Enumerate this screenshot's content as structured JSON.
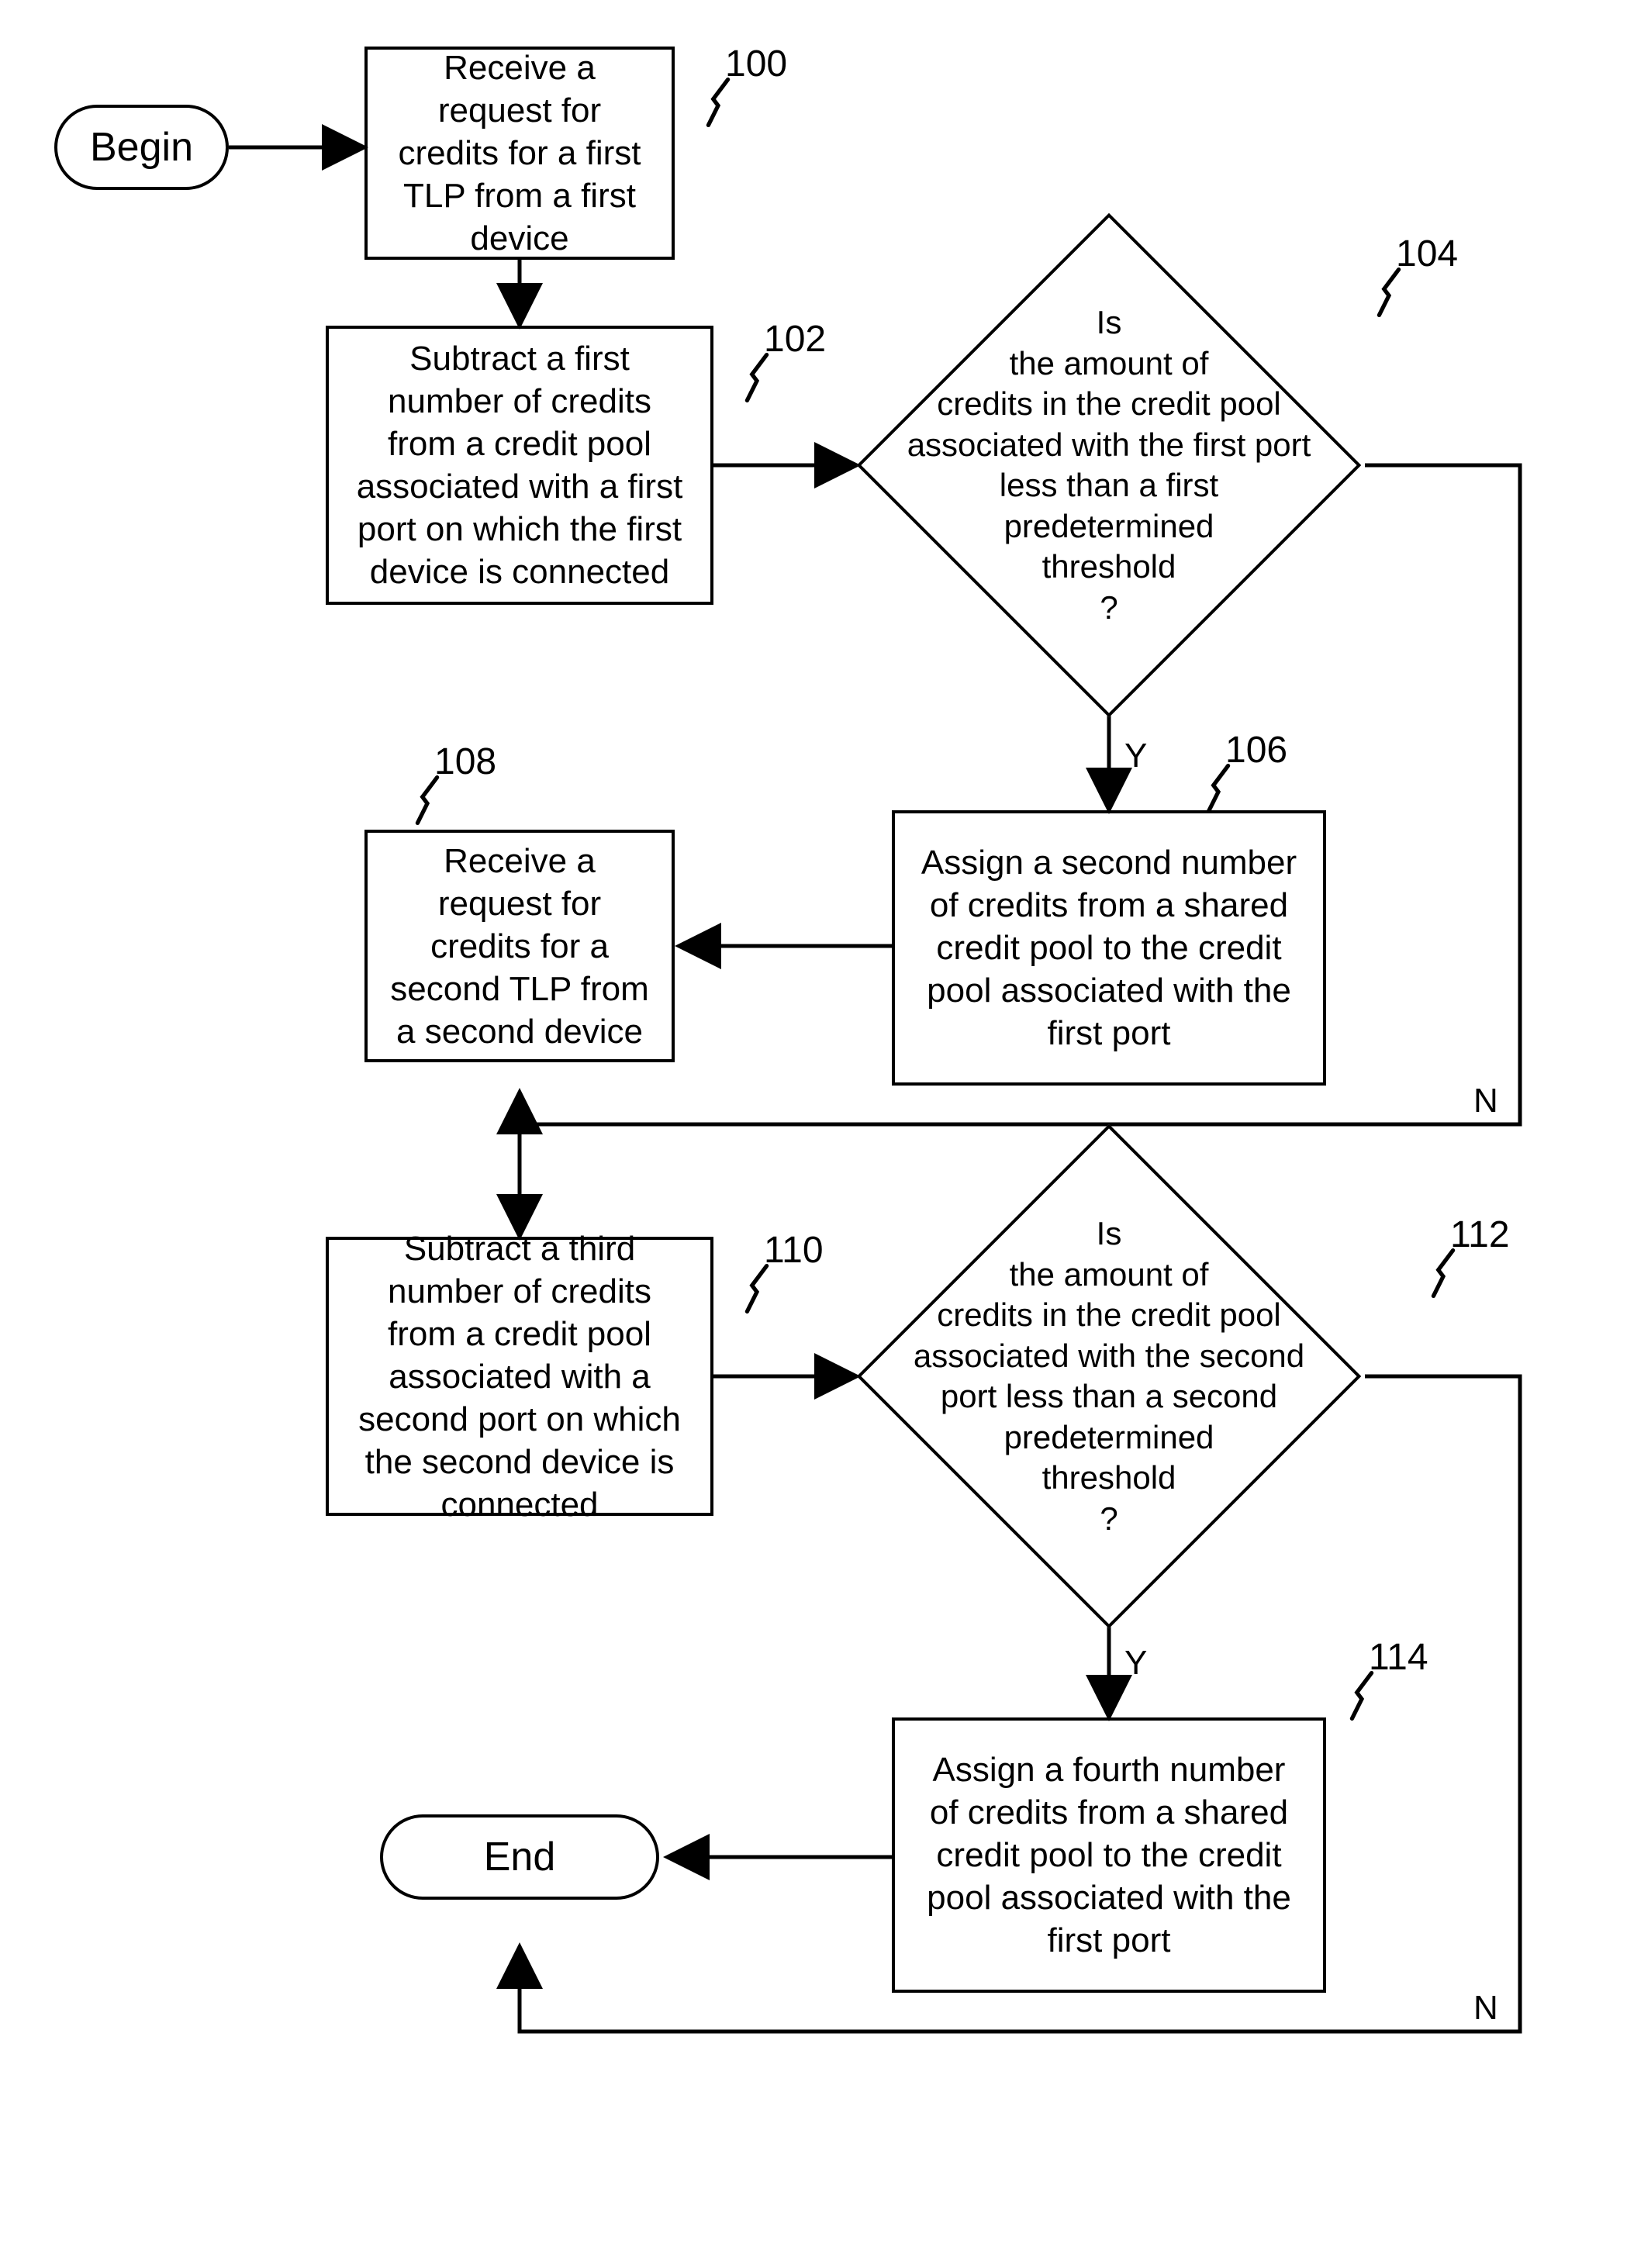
{
  "nodes": {
    "begin": {
      "label": "Begin"
    },
    "end": {
      "label": "End"
    },
    "step100": {
      "ref": "100",
      "text": "Receive a request for credits for a first TLP from a first device"
    },
    "step102": {
      "ref": "102",
      "text": "Subtract a first number of credits from a credit pool associated with a first port on which the first device is connected"
    },
    "dec104": {
      "ref": "104",
      "text": "Is\nthe amount of\ncredits in the credit pool\nassociated with the first port\nless than a first\npredetermined\nthreshold\n?"
    },
    "step106": {
      "ref": "106",
      "text": "Assign a second number of credits from a shared credit pool to the credit pool associated with the first port"
    },
    "step108": {
      "ref": "108",
      "text": "Receive a request for credits for a second TLP from a second device"
    },
    "step110": {
      "ref": "110",
      "text": "Subtract a third number of credits from a credit pool associated with a second port on which the second device is connected"
    },
    "dec112": {
      "ref": "112",
      "text": "Is\nthe amount of\ncredits in the credit pool\nassociated with the second\nport less than a second\npredetermined\nthreshold\n?"
    },
    "step114": {
      "ref": "114",
      "text": "Assign a fourth number of credits from a shared credit pool to the credit pool associated with the first port"
    }
  },
  "edge_labels": {
    "y1": "Y",
    "n1": "N",
    "y2": "Y",
    "n2": "N"
  }
}
